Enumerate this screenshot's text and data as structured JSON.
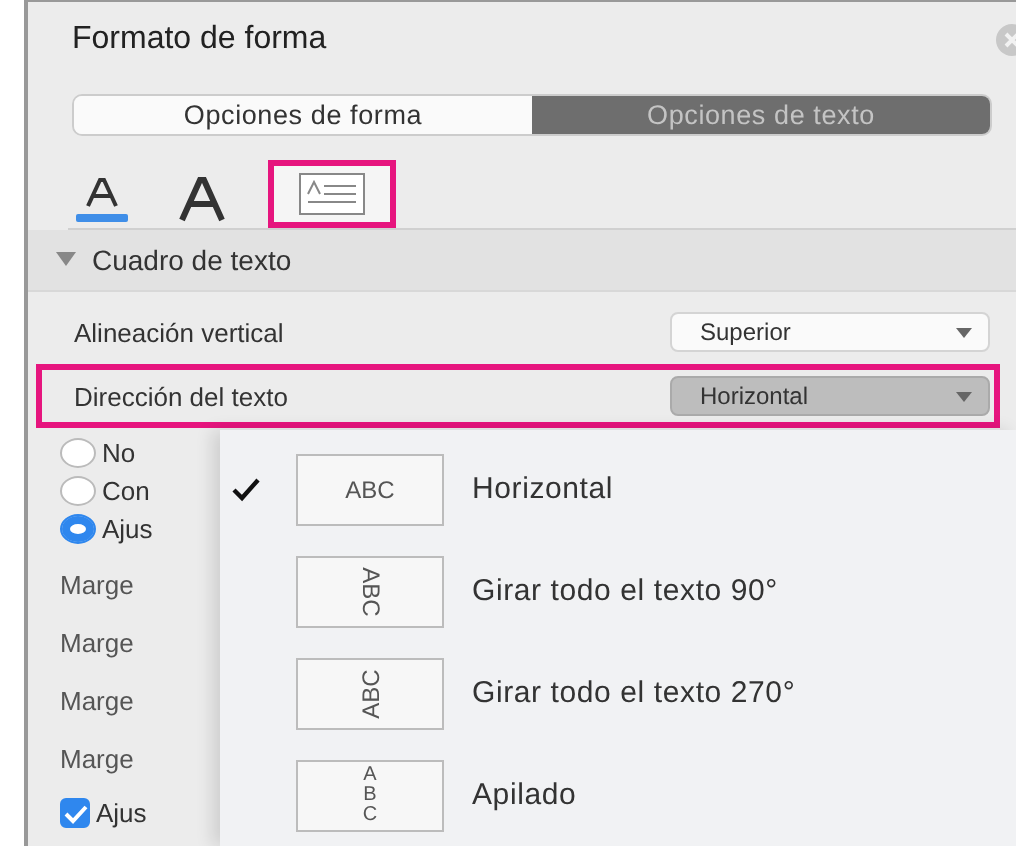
{
  "panel": {
    "title": "Formato de forma"
  },
  "segments": [
    {
      "label": "Opciones de forma",
      "selected": false
    },
    {
      "label": "Opciones de texto",
      "selected": true
    }
  ],
  "icon_tabs": [
    {
      "kind": "fill",
      "selected": false
    },
    {
      "kind": "effects",
      "selected": false
    },
    {
      "kind": "textbox",
      "selected": true
    }
  ],
  "section": {
    "title": "Cuadro de texto",
    "expanded": true
  },
  "rows": [
    {
      "label": "Alineación vertical",
      "value": "Superior",
      "active": false
    },
    {
      "label": "Dirección del texto",
      "value": "Horizontal",
      "active": true
    }
  ],
  "radios": [
    {
      "label": "No",
      "selected": false
    },
    {
      "label": "Con",
      "selected": false
    },
    {
      "label": "Ajus",
      "selected": true
    }
  ],
  "margins": [
    "Marge",
    "Marge",
    "Marge",
    "Marge"
  ],
  "checkbox": {
    "label": "Ajus",
    "checked": true
  },
  "menu": [
    {
      "kind": "horizontal",
      "sample": "ABC",
      "label": "Horizontal",
      "selected": true
    },
    {
      "kind": "rot90",
      "sample": "ABC",
      "label": "Girar todo el texto 90°",
      "selected": false
    },
    {
      "kind": "rot270",
      "sample": "ABC",
      "label": "Girar todo el texto 270°",
      "selected": false
    },
    {
      "kind": "stacked",
      "sample": "ABC",
      "label": "Apilado",
      "selected": false
    }
  ]
}
